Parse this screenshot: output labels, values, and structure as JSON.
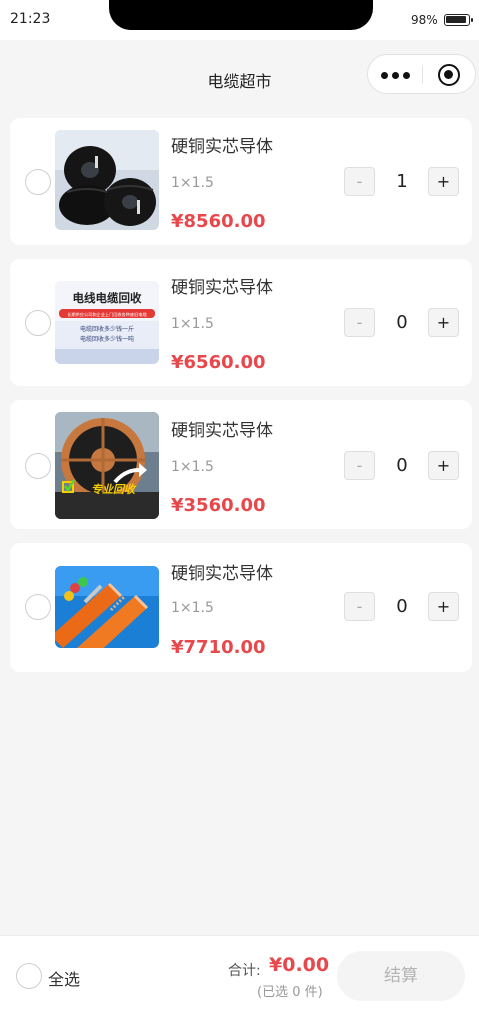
{
  "status_bar": {
    "time": "21:23",
    "battery": "98%"
  },
  "nav": {
    "title": "电缆超市"
  },
  "products": [
    {
      "title": "硬铜实芯导体",
      "spec": "1×1.5",
      "price": "¥8560.00",
      "quantity": "1",
      "minus": "-",
      "plus": "+"
    },
    {
      "title": "硬铜实芯导体",
      "spec": "1×1.5",
      "price": "¥6560.00",
      "quantity": "0",
      "minus": "-",
      "plus": "+",
      "image_text": {
        "headline": "电线电缆回收",
        "banner": "长期供应公司和企业上门回收各种废旧电缆",
        "line1": "电缆回收多少钱一斤",
        "line2": "电缆回收多少钱一吨"
      }
    },
    {
      "title": "硬铜实芯导体",
      "spec": "1×1.5",
      "price": "¥3560.00",
      "quantity": "0",
      "minus": "-",
      "plus": "+",
      "image_text": {
        "headline": "专业回收"
      }
    },
    {
      "title": "硬铜实芯导体",
      "spec": "1×1.5",
      "price": "¥7710.00",
      "quantity": "0",
      "minus": "-",
      "plus": "+"
    }
  ],
  "footer": {
    "select_all": "全选",
    "total_label": "合计:",
    "total_value": "¥0.00",
    "selected_count": "(已选 0 件)",
    "checkout": "结算"
  },
  "colors": {
    "price": "#e8474b",
    "background": "#f5f5f5"
  }
}
